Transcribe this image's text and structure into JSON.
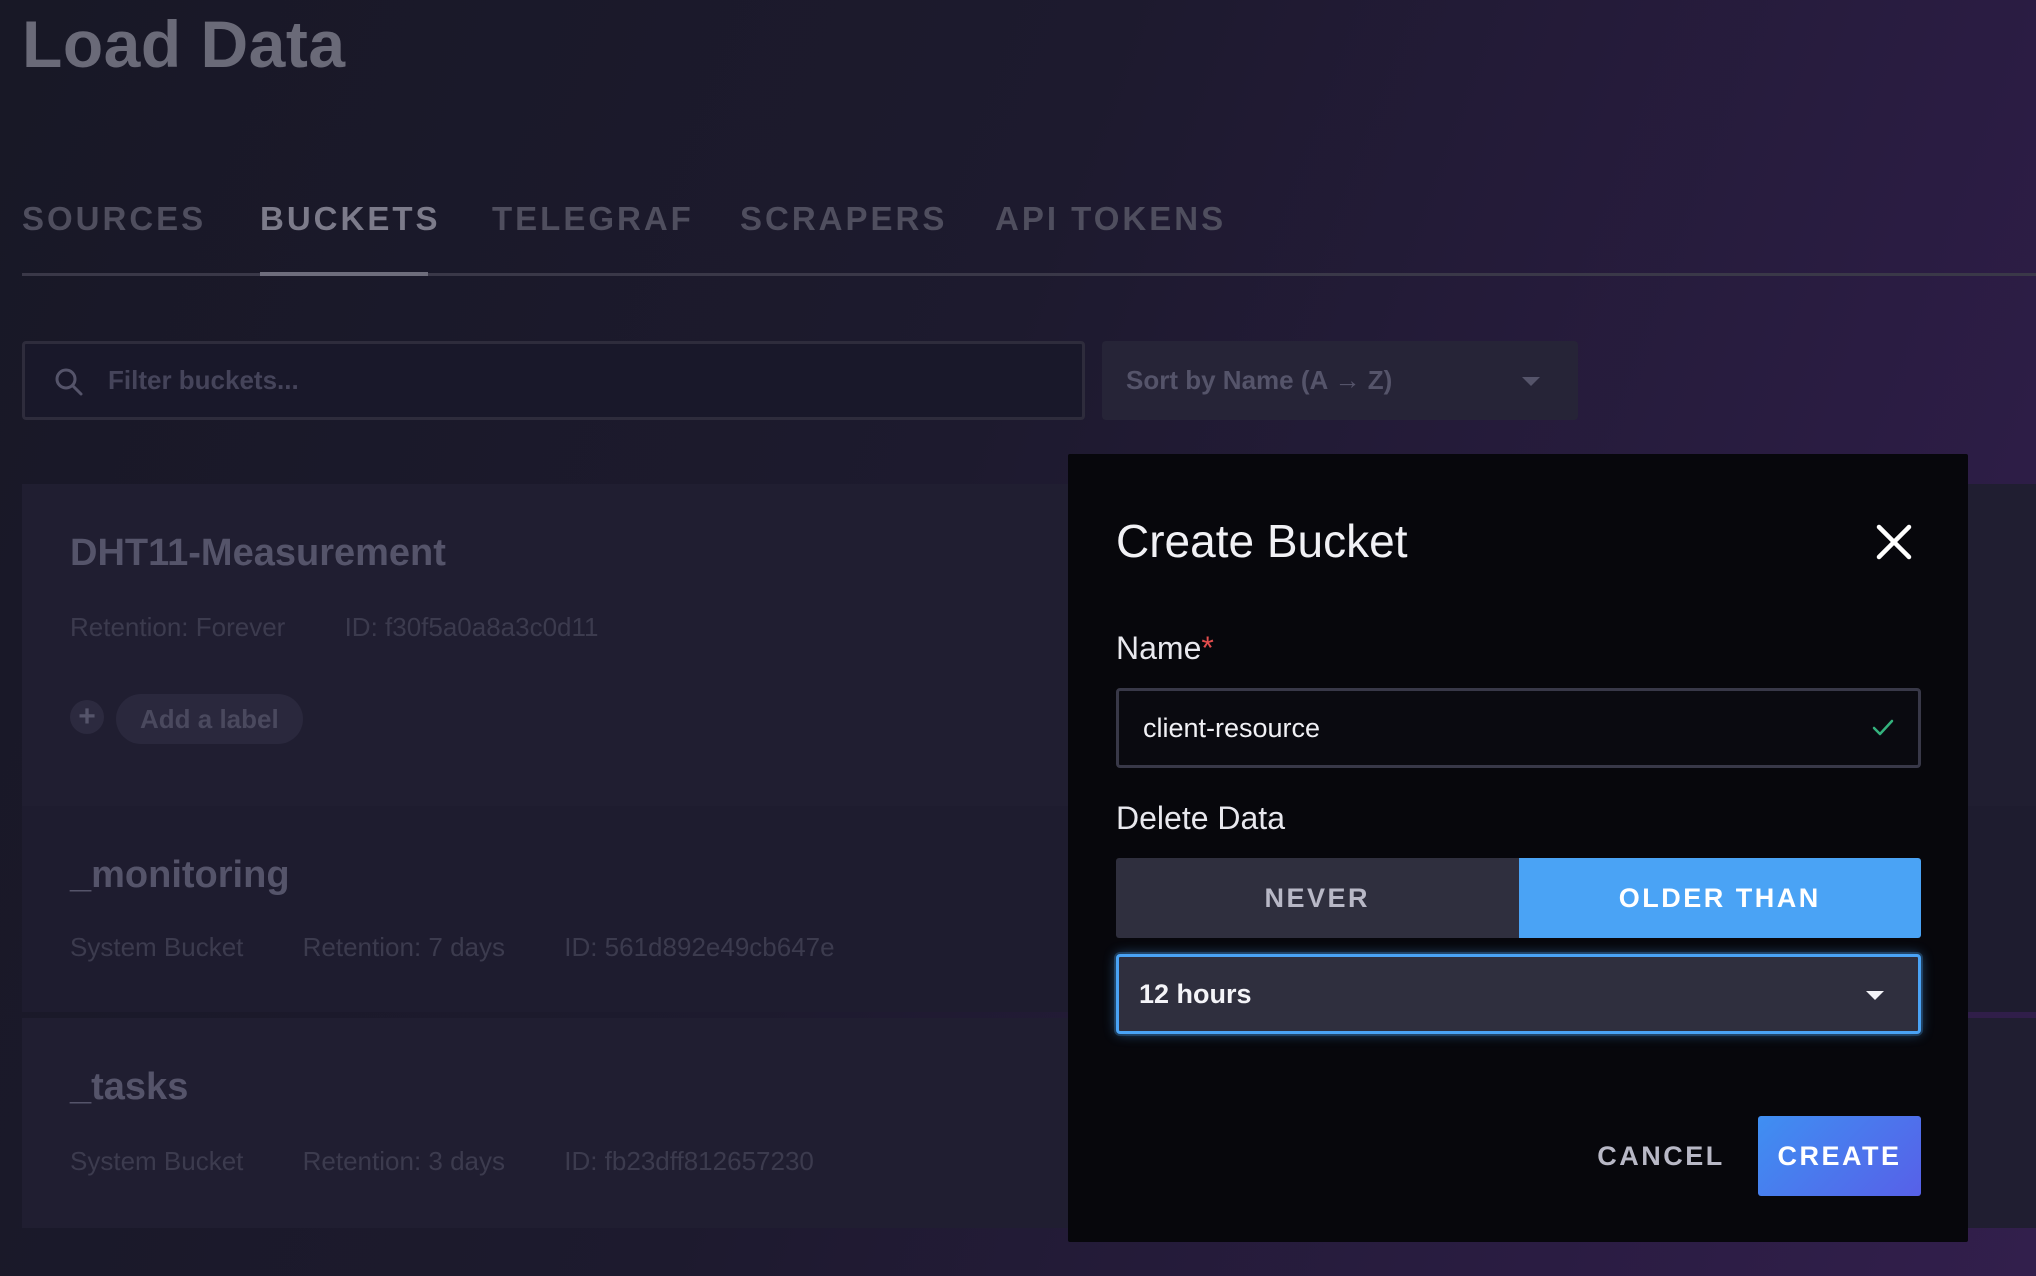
{
  "page": {
    "title": "Load Data",
    "tabs": [
      {
        "label": "SOURCES",
        "active": false
      },
      {
        "label": "BUCKETS",
        "active": true
      },
      {
        "label": "TELEGRAF",
        "active": false
      },
      {
        "label": "SCRAPERS",
        "active": false
      },
      {
        "label": "API TOKENS",
        "active": false
      }
    ],
    "filter": {
      "placeholder": "Filter buckets...",
      "icon": "search-icon"
    },
    "sort": {
      "label": "Sort by Name (A → Z)",
      "icon": "caret-down-icon"
    }
  },
  "buckets": [
    {
      "name": "DHT11-Measurement",
      "retention": "Retention: Forever",
      "id": "ID: f30f5a0a8a3c0d11",
      "add_label": "Add a label"
    },
    {
      "name": "_monitoring",
      "system": "System Bucket",
      "retention": "Retention: 7 days",
      "id": "ID: 561d892e49cb647e"
    },
    {
      "name": "_tasks",
      "system": "System Bucket",
      "retention": "Retention: 3 days",
      "id": "ID: fb23dff812657230"
    }
  ],
  "modal": {
    "title": "Create Bucket",
    "close_icon": "close-icon",
    "name_label": "Name",
    "required_mark": "*",
    "name_value": "client-resource",
    "name_valid_icon": "check-icon",
    "delete_label": "Delete Data",
    "delete_options": [
      "NEVER",
      "OLDER THAN"
    ],
    "delete_selected": "OLDER THAN",
    "retention_value": "12 hours",
    "cancel_label": "CANCEL",
    "create_label": "CREATE"
  },
  "colors": {
    "accent": "#4aa3f5",
    "create_gradient_start": "#3f8ff2",
    "create_gradient_end": "#5760e8",
    "required": "#e24d4d",
    "valid": "#34b27d"
  }
}
